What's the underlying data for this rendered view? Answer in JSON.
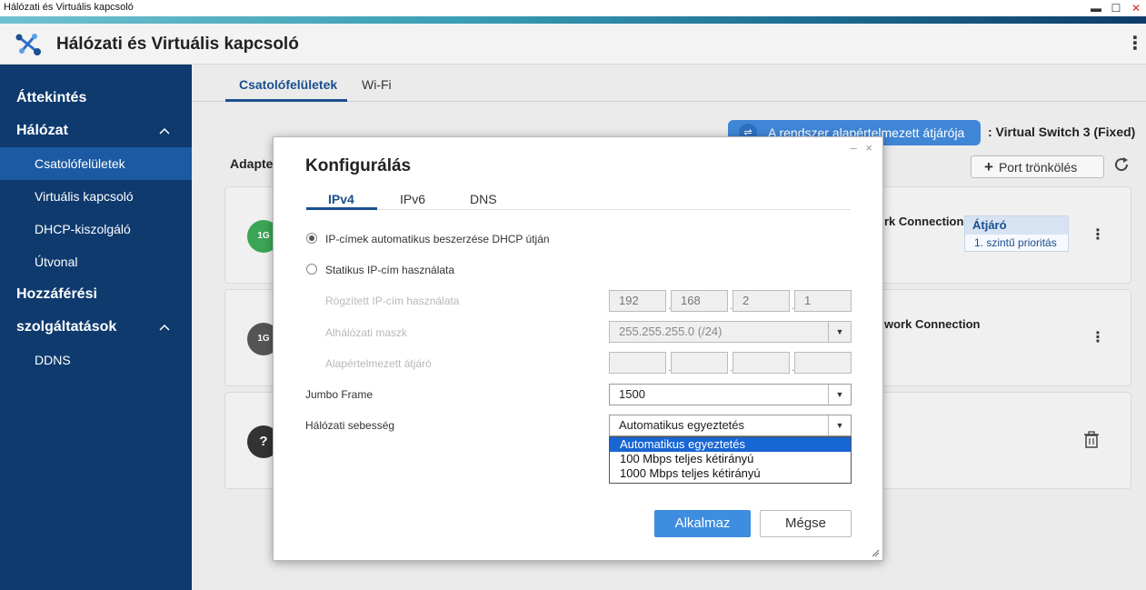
{
  "os": {
    "window_title": "Hálózati és Virtuális kapcsoló",
    "minimize": "▬",
    "maximize": "☐",
    "close": "✕"
  },
  "app": {
    "title": "Hálózati és Virtuális kapcsoló",
    "more": "⋮"
  },
  "sidebar": {
    "overview": "Áttekintés",
    "network": "Hálózat",
    "network_chevron": "^",
    "items": [
      {
        "label": "Csatolófelületek",
        "active": true
      },
      {
        "label": "Virtuális kapcsoló"
      },
      {
        "label": "DHCP-kiszolgáló"
      },
      {
        "label": "Útvonal"
      }
    ],
    "access_line1": "Hozzáférési",
    "access_line2": "szolgáltatások",
    "access_chevron": "^",
    "ddns": "DDNS"
  },
  "main": {
    "tabs": [
      {
        "label": "Csatolófelületek",
        "active": true
      },
      {
        "label": "Wi-Fi"
      }
    ],
    "gateway_pill": "A rendszer alapértelmezett átjárója",
    "gateway_value": ": Virtual Switch 3 (Fixed)",
    "port_trunk": "Port trönkölés",
    "adapter_label": "Adapte",
    "cards": [
      {
        "icon": "1G",
        "connection": "rk Connection",
        "badge_top": "Átjáró",
        "badge_bottom": "1. szintű prioritás"
      },
      {
        "icon": "1G",
        "connection": "work Connection"
      },
      {
        "icon": "?"
      }
    ]
  },
  "modal": {
    "title": "Konfigurálás",
    "window_controls": "– ×",
    "tabs": [
      {
        "label": "IPv4",
        "active": true
      },
      {
        "label": "IPv6"
      },
      {
        "label": "DNS"
      }
    ],
    "dhcp_option": "IP-címek automatikus beszerzése DHCP útján",
    "static_option": "Statikus IP-cím használata",
    "fixed_ip_label": "Rögzített IP-cím használata",
    "fixed_ip": [
      "192",
      "168",
      "2",
      "1"
    ],
    "subnet_label": "Alhálózati maszk",
    "subnet_value": "255.255.255.0 (/24)",
    "gateway_label": "Alapértelmezett átjáró",
    "gateway_ip": [
      "",
      "",
      "",
      ""
    ],
    "jumbo_label": "Jumbo Frame",
    "jumbo_value": "1500",
    "speed_label": "Hálózati sebesség",
    "speed_value": "Automatikus egyeztetés",
    "speed_options": [
      "Automatikus egyeztetés",
      "100 Mbps teljes kétirányú",
      "1000 Mbps teljes kétirányú"
    ],
    "apply": "Alkalmaz",
    "cancel": "Mégse"
  },
  "colors": {
    "sidebar": "#0e3a6e",
    "sidebar_active": "#1c5aa3",
    "accent": "#3f8de0",
    "card_green": "#3aa655",
    "card_gray": "#555555"
  }
}
